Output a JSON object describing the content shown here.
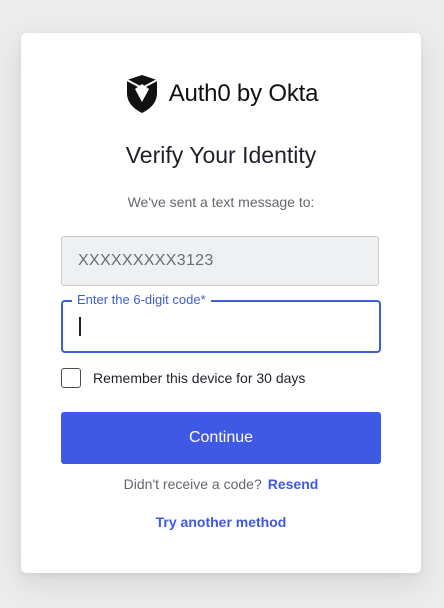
{
  "brand": {
    "name": "Auth0 by Okta",
    "logo_icon": "auth0-shield-icon",
    "primary_color": "#3f59e4"
  },
  "page": {
    "title": "Verify Your Identity",
    "subtitle": "We've sent a text message to:"
  },
  "phone": {
    "value": "XXXXXXXXX3123"
  },
  "code_field": {
    "label": "Enter the 6-digit code*",
    "value": ""
  },
  "remember": {
    "label": "Remember this device for 30 days",
    "checked": false
  },
  "actions": {
    "continue_label": "Continue",
    "resend_question": "Didn't receive a code?",
    "resend_label": "Resend",
    "try_another_label": "Try another method"
  }
}
